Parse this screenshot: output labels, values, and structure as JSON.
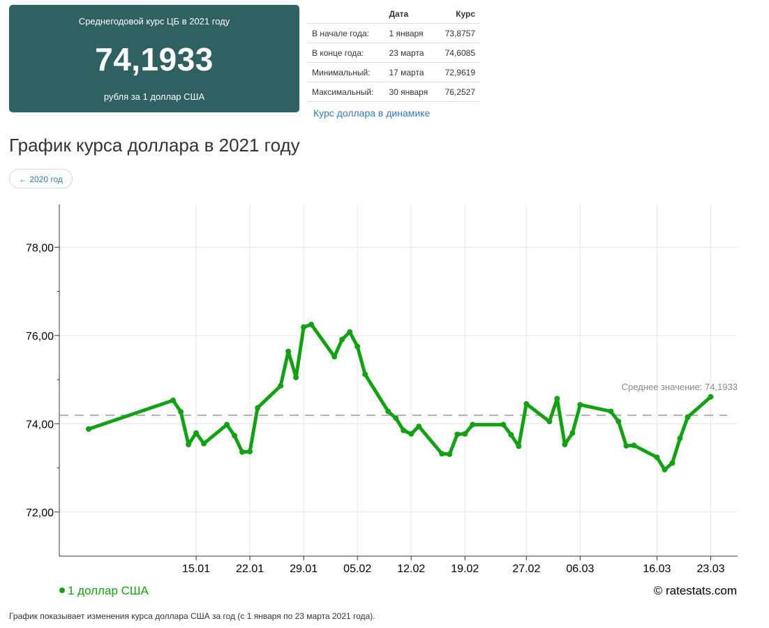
{
  "summary": {
    "caption": "Среднегодовой курс ЦБ в 2021 году",
    "value": "74,1933",
    "unit": "рубля за 1 доллар США"
  },
  "stats_table": {
    "headers": [
      "",
      "Дата",
      "Курс"
    ],
    "rows": [
      [
        "В начале года:",
        "1 января",
        "73,8757"
      ],
      [
        "В конце года:",
        "23 марта",
        "74,6085"
      ],
      [
        "Минимальный:",
        "17 марта",
        "72,9619"
      ],
      [
        "Максимальный:",
        "30 января",
        "76,2527"
      ]
    ]
  },
  "dynamics_link": "Курс доллара в динамике",
  "page_title": "График курса доллара в 2021 году",
  "prev_year_button": "← 2020 год",
  "footnote": "График показывает изменения курса доллара США за год (с 1 января по 23 марта 2021 года).",
  "colors": {
    "card_bg": "#2f6062",
    "line": "#13a013",
    "link": "#337ab7",
    "avg_line": "#999999"
  },
  "chart_data": {
    "type": "line",
    "title": "",
    "xlabel": "",
    "ylabel": "",
    "x_axis": {
      "start": "2021-01-09",
      "end": "2021-03-23"
    },
    "x_ticks": [
      {
        "date": "2021-01-15",
        "label": "15.01"
      },
      {
        "date": "2021-01-22",
        "label": "22.01"
      },
      {
        "date": "2021-01-29",
        "label": "29.01"
      },
      {
        "date": "2021-02-05",
        "label": "05.02"
      },
      {
        "date": "2021-02-12",
        "label": "12.02"
      },
      {
        "date": "2021-02-19",
        "label": "19.02"
      },
      {
        "date": "2021-02-27",
        "label": "27.02"
      },
      {
        "date": "2021-03-06",
        "label": "06.03"
      },
      {
        "date": "2021-03-16",
        "label": "16.03"
      },
      {
        "date": "2021-03-23",
        "label": "23.03"
      }
    ],
    "ylim": [
      71,
      78.97
    ],
    "y_ticks": [
      {
        "value": 72,
        "label": "72,00"
      },
      {
        "value": 74,
        "label": "74,00"
      },
      {
        "value": 76,
        "label": "76,00"
      },
      {
        "value": 78,
        "label": "78,00"
      }
    ],
    "grid": true,
    "legend": {
      "position": "bottom-left",
      "label": "1 доллар США"
    },
    "watermark": "© ratestats.com",
    "average": {
      "value": 74.1933,
      "label": "Среднее значение: 74,1933"
    },
    "series": [
      {
        "name": "1 доллар США",
        "points": [
          [
            "2021-01-01",
            73.88
          ],
          [
            "2021-01-12",
            74.53
          ],
          [
            "2021-01-13",
            74.27
          ],
          [
            "2021-01-14",
            73.53
          ],
          [
            "2021-01-15",
            73.79
          ],
          [
            "2021-01-16",
            73.55
          ],
          [
            "2021-01-19",
            73.98
          ],
          [
            "2021-01-20",
            73.73
          ],
          [
            "2021-01-21",
            73.36
          ],
          [
            "2021-01-22",
            73.37
          ],
          [
            "2021-01-23",
            74.36
          ],
          [
            "2021-01-26",
            74.86
          ],
          [
            "2021-01-27",
            75.64
          ],
          [
            "2021-01-28",
            75.05
          ],
          [
            "2021-01-29",
            76.19
          ],
          [
            "2021-01-30",
            76.25
          ],
          [
            "2021-02-02",
            75.52
          ],
          [
            "2021-02-03",
            75.91
          ],
          [
            "2021-02-04",
            76.08
          ],
          [
            "2021-02-05",
            75.75
          ],
          [
            "2021-02-06",
            75.12
          ],
          [
            "2021-02-09",
            74.28
          ],
          [
            "2021-02-10",
            74.13
          ],
          [
            "2021-02-11",
            73.85
          ],
          [
            "2021-02-12",
            73.77
          ],
          [
            "2021-02-13",
            73.94
          ],
          [
            "2021-02-16",
            73.32
          ],
          [
            "2021-02-17",
            73.31
          ],
          [
            "2021-02-18",
            73.76
          ],
          [
            "2021-02-19",
            73.77
          ],
          [
            "2021-02-20",
            73.98
          ],
          [
            "2021-02-24",
            73.98
          ],
          [
            "2021-02-25",
            73.75
          ],
          [
            "2021-02-26",
            73.49
          ],
          [
            "2021-02-27",
            74.45
          ],
          [
            "2021-03-02",
            74.05
          ],
          [
            "2021-03-03",
            74.57
          ],
          [
            "2021-03-04",
            73.53
          ],
          [
            "2021-03-05",
            73.79
          ],
          [
            "2021-03-06",
            74.43
          ],
          [
            "2021-03-10",
            74.28
          ],
          [
            "2021-03-11",
            74.05
          ],
          [
            "2021-03-12",
            73.5
          ],
          [
            "2021-03-13",
            73.51
          ],
          [
            "2021-03-16",
            73.24
          ],
          [
            "2021-03-17",
            72.96
          ],
          [
            "2021-03-18",
            73.11
          ],
          [
            "2021-03-19",
            73.67
          ],
          [
            "2021-03-20",
            74.15
          ],
          [
            "2021-03-23",
            74.61
          ]
        ]
      }
    ]
  }
}
